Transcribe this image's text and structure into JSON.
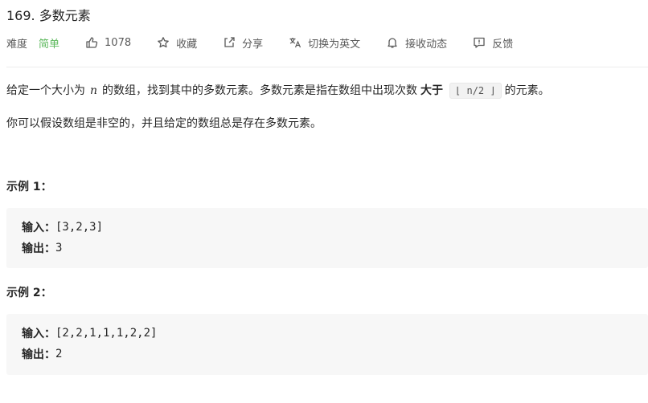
{
  "problem": {
    "title": "169. 多数元素",
    "difficulty_label": "难度",
    "difficulty": "简单",
    "likes": "1078",
    "actions": {
      "favorite": "收藏",
      "share": "分享",
      "switch_lang": "切换为英文",
      "notify": "接收动态",
      "feedback": "反馈"
    },
    "description": {
      "part1": "给定一个大小为",
      "var_n": "n",
      "part2": "的数组，找到其中的多数元素。多数元素是指在数组中出现次数",
      "bold": "大于",
      "code": "⌊ n/2 ⌋",
      "part3": "的元素。"
    },
    "description2": "你可以假设数组是非空的，并且给定的数组总是存在多数元素。",
    "examples": [
      {
        "title": "示例 1：",
        "input_label": "输入：",
        "input": "[3,2,3]",
        "output_label": "输出：",
        "output": "3"
      },
      {
        "title": "示例 2：",
        "input_label": "输入：",
        "input": "[2,2,1,1,1,2,2]",
        "output_label": "输出：",
        "output": "2"
      }
    ]
  },
  "colors": {
    "difficulty_easy": "#5cb85c",
    "example_bg": "#f7f7f7"
  }
}
